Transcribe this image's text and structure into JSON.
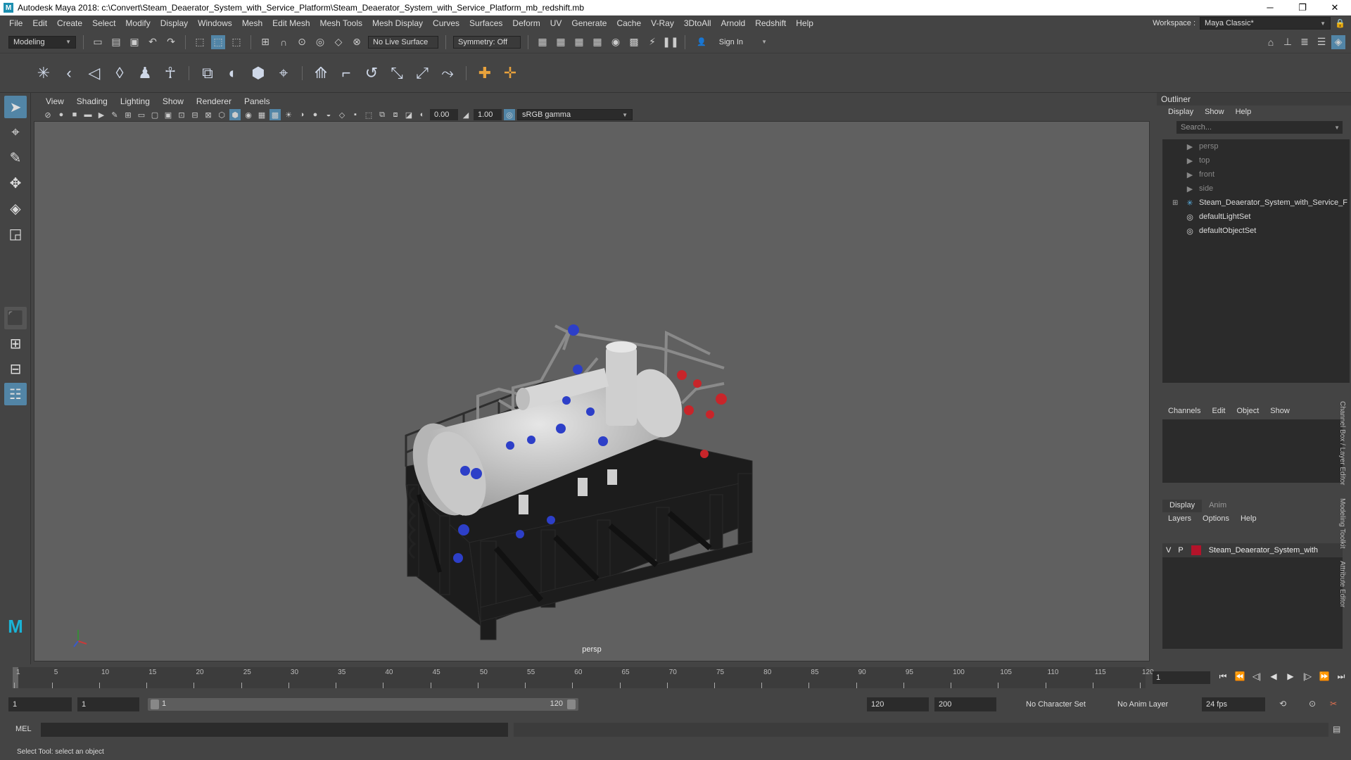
{
  "window": {
    "title": "Autodesk Maya 2018: c:\\Convert\\Steam_Deaerator_System_with_Service_Platform\\Steam_Deaerator_System_with_Service_Platform_mb_redshift.mb",
    "logo": "M"
  },
  "menubar": {
    "items": [
      "File",
      "Edit",
      "Create",
      "Select",
      "Modify",
      "Display",
      "Windows",
      "Mesh",
      "Edit Mesh",
      "Mesh Tools",
      "Mesh Display",
      "Curves",
      "Surfaces",
      "Deform",
      "UV",
      "Generate",
      "Cache",
      "V-Ray",
      "3DtoAll",
      "Arnold",
      "Redshift",
      "Help"
    ],
    "workspace_label": "Workspace :",
    "workspace_value": "Maya Classic*"
  },
  "statusline": {
    "mode": "Modeling",
    "live_surface": "No Live Surface",
    "symmetry": "Symmetry: Off",
    "sign_in": "Sign In"
  },
  "viewport": {
    "menu": [
      "View",
      "Shading",
      "Lighting",
      "Show",
      "Renderer",
      "Panels"
    ],
    "exposure": "0.00",
    "gamma": "1.00",
    "color_space": "sRGB gamma",
    "camera": "persp"
  },
  "outliner": {
    "title": "Outliner",
    "menu": [
      "Display",
      "Show",
      "Help"
    ],
    "search_placeholder": "Search...",
    "items": [
      {
        "label": "persp",
        "icon": "camera-icon",
        "dim": true
      },
      {
        "label": "top",
        "icon": "camera-icon",
        "dim": true
      },
      {
        "label": "front",
        "icon": "camera-icon",
        "dim": true
      },
      {
        "label": "side",
        "icon": "camera-icon",
        "dim": true
      },
      {
        "label": "Steam_Deaerator_System_with_Service_F",
        "icon": "group-icon",
        "dim": false
      },
      {
        "label": "defaultLightSet",
        "icon": "set-icon",
        "dim": false
      },
      {
        "label": "defaultObjectSet",
        "icon": "set-icon",
        "dim": false
      }
    ]
  },
  "channelbox": {
    "menu": [
      "Channels",
      "Edit",
      "Object",
      "Show"
    ]
  },
  "layers": {
    "tabs": [
      "Display",
      "Anim"
    ],
    "menu": [
      "Layers",
      "Options",
      "Help"
    ],
    "row": {
      "v": "V",
      "p": "P",
      "name": "Steam_Deaerator_System_with",
      "color": "#b3132a"
    }
  },
  "sidetabs": [
    "Channel Box / Layer Editor",
    "Modeling Toolkit",
    "Attribute Editor"
  ],
  "timeslider": {
    "labels": [
      "1",
      "5",
      "10",
      "15",
      "20",
      "25",
      "30",
      "35",
      "40",
      "45",
      "50",
      "55",
      "60",
      "65",
      "70",
      "75",
      "80",
      "85",
      "90",
      "95",
      "100",
      "105",
      "110",
      "115",
      "120"
    ],
    "current_frame": "1"
  },
  "rangeslider": {
    "start": "1",
    "inner_start": "1",
    "bar_start": "1",
    "bar_end": "120",
    "end": "120",
    "outer_end": "200",
    "character_set": "No Character Set",
    "anim_layer": "No Anim Layer",
    "fps": "24 fps"
  },
  "cmdline": {
    "label": "MEL"
  },
  "helpline": {
    "text": "Select Tool: select an object"
  }
}
